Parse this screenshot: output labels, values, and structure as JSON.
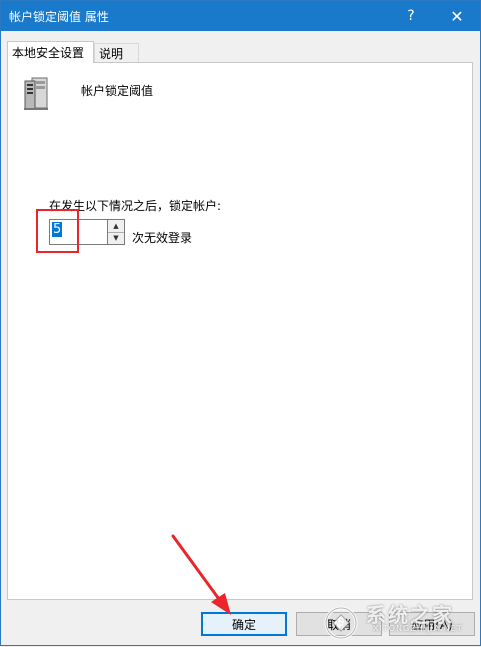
{
  "window": {
    "title": "帐户锁定阈值 属性",
    "help_glyph": "?",
    "close_glyph": "✕"
  },
  "tabs": [
    {
      "label": "本地安全设置",
      "active": true
    },
    {
      "label": "说明",
      "active": false
    }
  ],
  "policy": {
    "icon": "server-tower-icon",
    "name": "帐户锁定阈值"
  },
  "threshold": {
    "description": "在发生以下情况之后，锁定帐户:",
    "value": "5",
    "unit_label": "次无效登录"
  },
  "buttons": {
    "ok_label": "确定",
    "cancel_label": "取消",
    "apply_label": "应用(A)"
  },
  "watermark": {
    "text": "系统之家",
    "sub": "XITONGZHIJIA.NET"
  },
  "colors": {
    "titlebar": "#1979ca",
    "highlight": "#e8262b",
    "selection": "#0078d7"
  }
}
